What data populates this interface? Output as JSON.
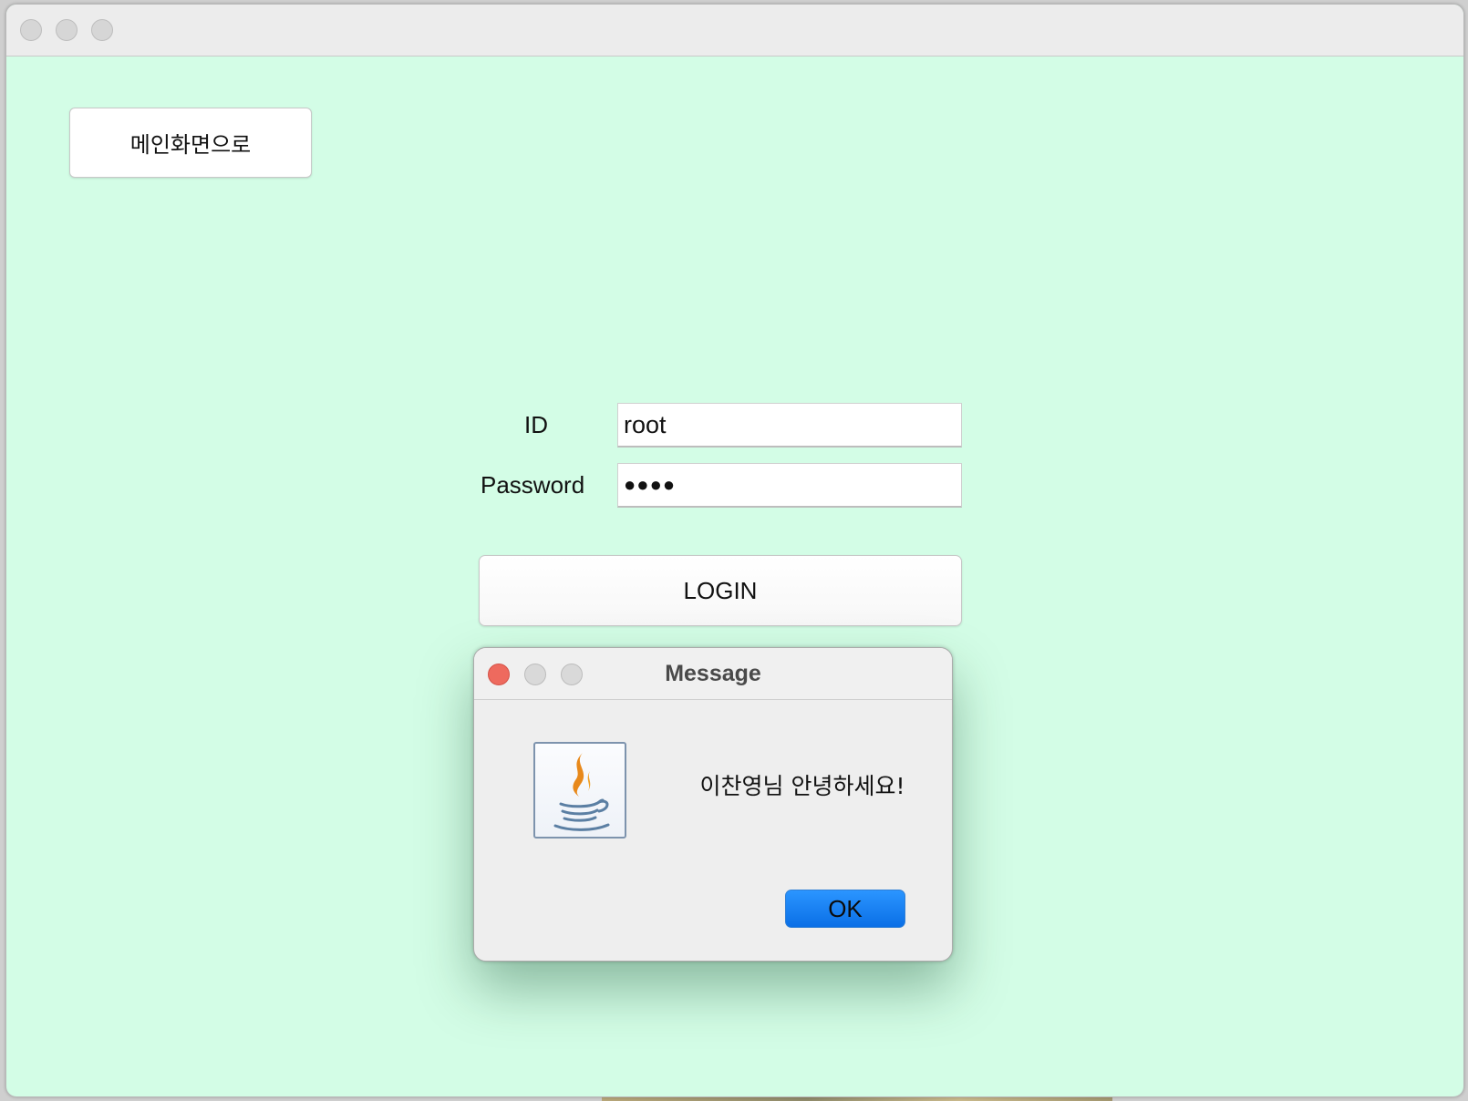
{
  "window": {
    "background_color": "#d3fde6"
  },
  "main_button": {
    "label": "메인화면으로"
  },
  "form": {
    "id_label": "ID",
    "id_value": "root",
    "password_label": "Password",
    "password_value": "●●●●",
    "login_label": "LOGIN"
  },
  "dialog": {
    "title": "Message",
    "message": "이찬영님 안녕하세요!",
    "ok_label": "OK",
    "icon": "java-icon"
  }
}
